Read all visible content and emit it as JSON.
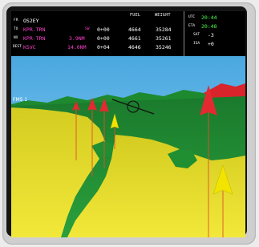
{
  "header": {
    "fuel_label": "FUEL",
    "weight_label": "WEIGHT"
  },
  "waypoints": [
    {
      "mode": "FR",
      "name": "OS2EY",
      "dist": "",
      "time": "",
      "fuel": "",
      "weight": "",
      "current": true
    },
    {
      "mode": "TO",
      "name": "KPR-TRN",
      "dist": "",
      "time": "0+00",
      "fuel": "4664",
      "weight": "35284",
      "mag_prefix": "SW"
    },
    {
      "mode": "NX",
      "name": "KPR-TRN",
      "dist": "3.9NM",
      "time": "0+00",
      "fuel": "4661",
      "weight": "35261"
    },
    {
      "mode": "DEST",
      "name": "KSVC",
      "dist": "14.0NM",
      "time": "0+04",
      "fuel": "4646",
      "weight": "35246"
    }
  ],
  "time_panel": {
    "utc_label": "UTC",
    "utc_value": "20:44",
    "eta_label": "ETA",
    "eta_value": "20:48",
    "sat_label": "SAT",
    "sat_value": "-3",
    "isa_label": "ISA",
    "isa_value": "+0"
  },
  "svs": {
    "fms_label": "FMS 1",
    "sky_color": "#59b6e6",
    "terrain_yellow": "#e6dc24",
    "terrain_green": "#1f8f32",
    "terrain_red": "#d8242a",
    "markers": [
      {
        "name": "red-waypoint-marker-1",
        "color": "red"
      },
      {
        "name": "red-waypoint-marker-2",
        "color": "red"
      },
      {
        "name": "red-waypoint-marker-3",
        "color": "red"
      },
      {
        "name": "yellow-waypoint-marker-1",
        "color": "yellow"
      },
      {
        "name": "red-waypoint-marker-4",
        "color": "red"
      },
      {
        "name": "yellow-waypoint-marker-2",
        "color": "yellow"
      }
    ]
  }
}
